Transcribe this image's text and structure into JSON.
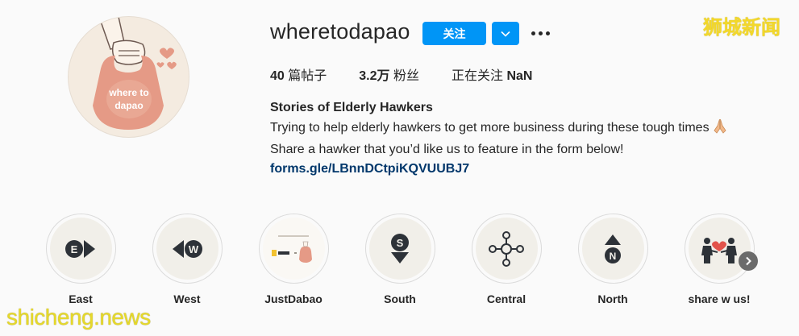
{
  "profile": {
    "username": "wheretodapao",
    "follow_label": "关注",
    "avatar_text_line1": "where to",
    "avatar_text_line2": "dapao",
    "colors": {
      "follow_blue": "#0095f6",
      "link": "#00376b",
      "avatar_bag": "#e59a86",
      "avatar_bg": "#f4ebe0"
    }
  },
  "stats": {
    "posts_value": "40",
    "posts_label": "篇帖子",
    "followers_value": "3.2万",
    "followers_label": "粉丝",
    "following_label": "正在关注",
    "following_value": "NaN"
  },
  "bio": {
    "name": "Stories of Elderly Hawkers",
    "line1": "Trying to help elderly hawkers to get more business during these tough times",
    "line2": "Share a hawker that you’d like us to feature in the form below!",
    "link": "forms.gle/LBnnDCtpiKQVUUBJ7"
  },
  "highlights": [
    {
      "label": "East",
      "icon": "east-compass-icon"
    },
    {
      "label": "West",
      "icon": "west-compass-icon"
    },
    {
      "label": "JustDabao",
      "icon": "justdabao-collab-icon"
    },
    {
      "label": "South",
      "icon": "south-compass-icon"
    },
    {
      "label": "Central",
      "icon": "central-compass-icon"
    },
    {
      "label": "North",
      "icon": "north-compass-icon"
    },
    {
      "label": "share w us!",
      "icon": "share-people-heart-icon"
    }
  ],
  "watermarks": {
    "top_right": "狮城新闻",
    "bottom_left": "shicheng.news"
  }
}
